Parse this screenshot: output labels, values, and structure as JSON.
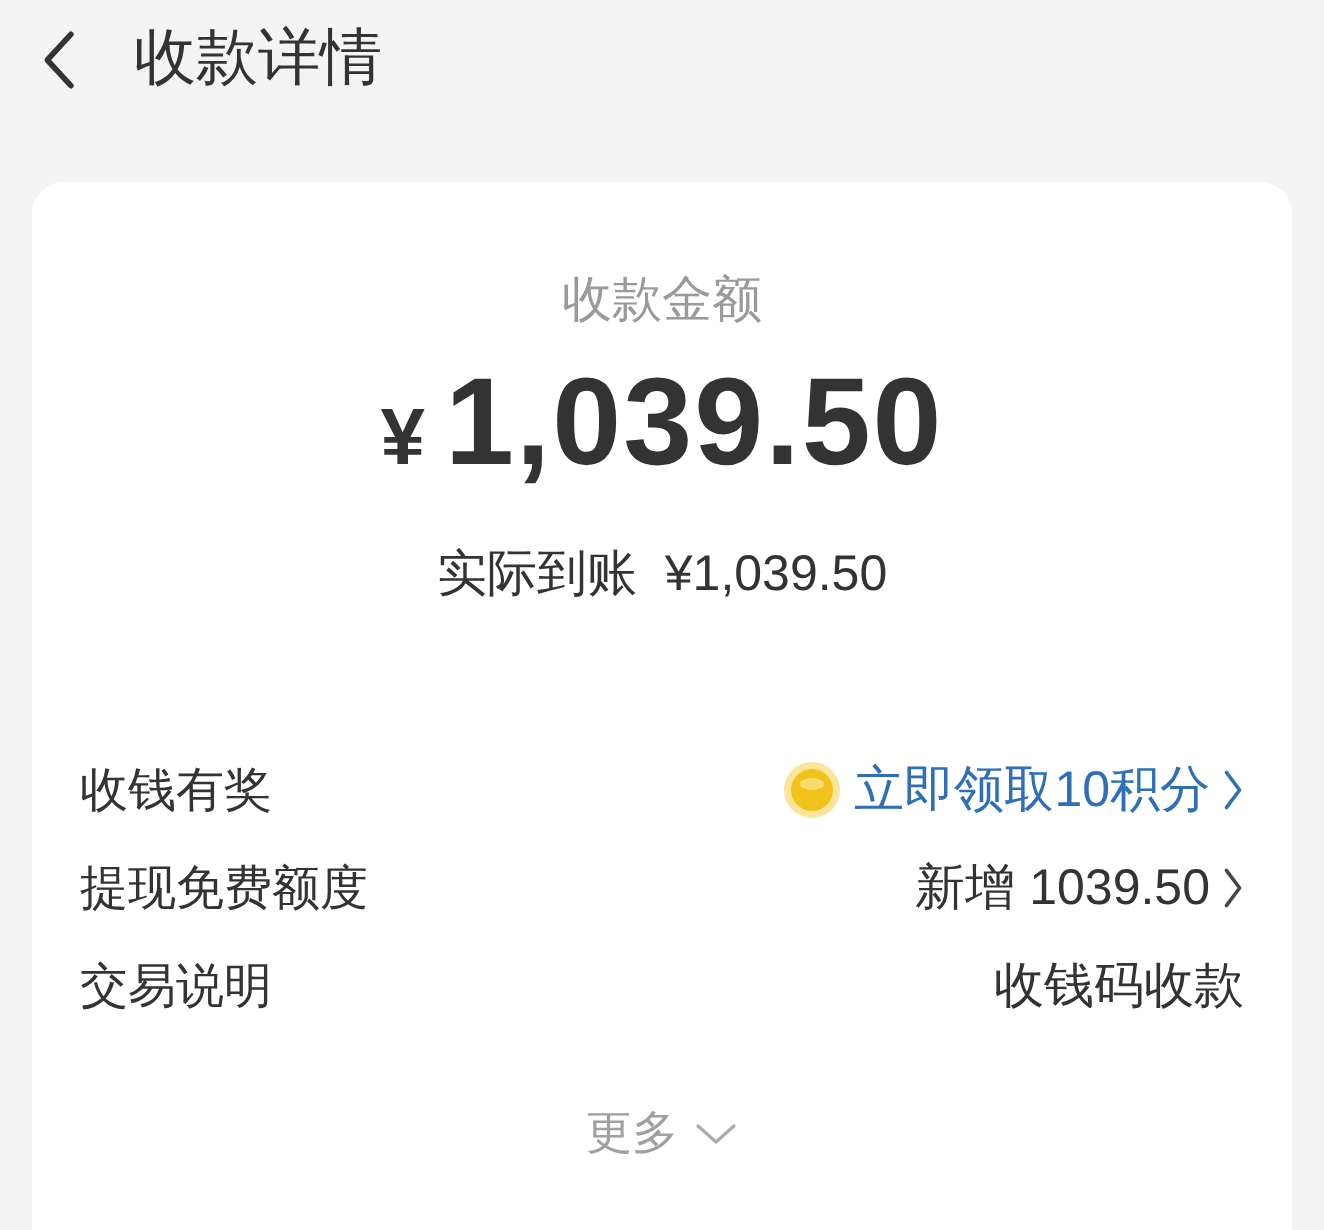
{
  "header": {
    "title": "收款详情"
  },
  "amount": {
    "label": "收款金额",
    "currency": "¥",
    "value": "1,039.50"
  },
  "received": {
    "label": "实际到账",
    "value": "¥1,039.50"
  },
  "rows": [
    {
      "kind": "link",
      "label": "收钱有奖",
      "value": "立即领取10积分",
      "chevron": true
    },
    {
      "kind": "text",
      "label": "提现免费额度",
      "value": "新增 1039.50",
      "chevron": true
    },
    {
      "kind": "text",
      "label": "交易说明",
      "value": "收钱码收款",
      "chevron": false
    }
  ],
  "more": {
    "label": "更多"
  }
}
